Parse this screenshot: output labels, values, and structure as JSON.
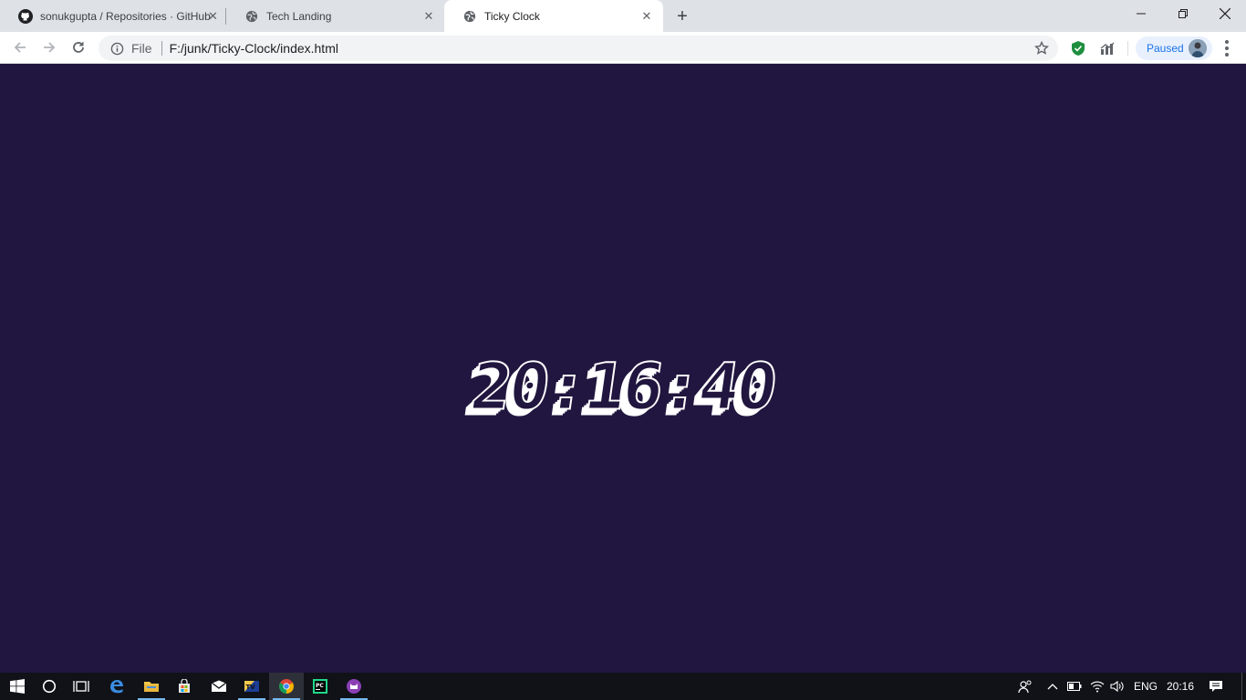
{
  "browser": {
    "tabs": [
      {
        "title": "sonukgupta / Repositories · GitHub",
        "icon": "github-icon"
      },
      {
        "title": "Tech Landing",
        "icon": "globe-icon"
      },
      {
        "title": "Ticky Clock",
        "icon": "globe-icon",
        "active": true
      }
    ],
    "address": {
      "scheme_label": "File",
      "url": "F:/junk/Ticky-Clock/index.html"
    },
    "profile": {
      "status": "Paused"
    }
  },
  "page": {
    "clock_time": "20:16:40",
    "background_color": "#21163f",
    "digit_color": "#ffffff"
  },
  "taskbar": {
    "language": "ENG",
    "time": "20:16"
  }
}
